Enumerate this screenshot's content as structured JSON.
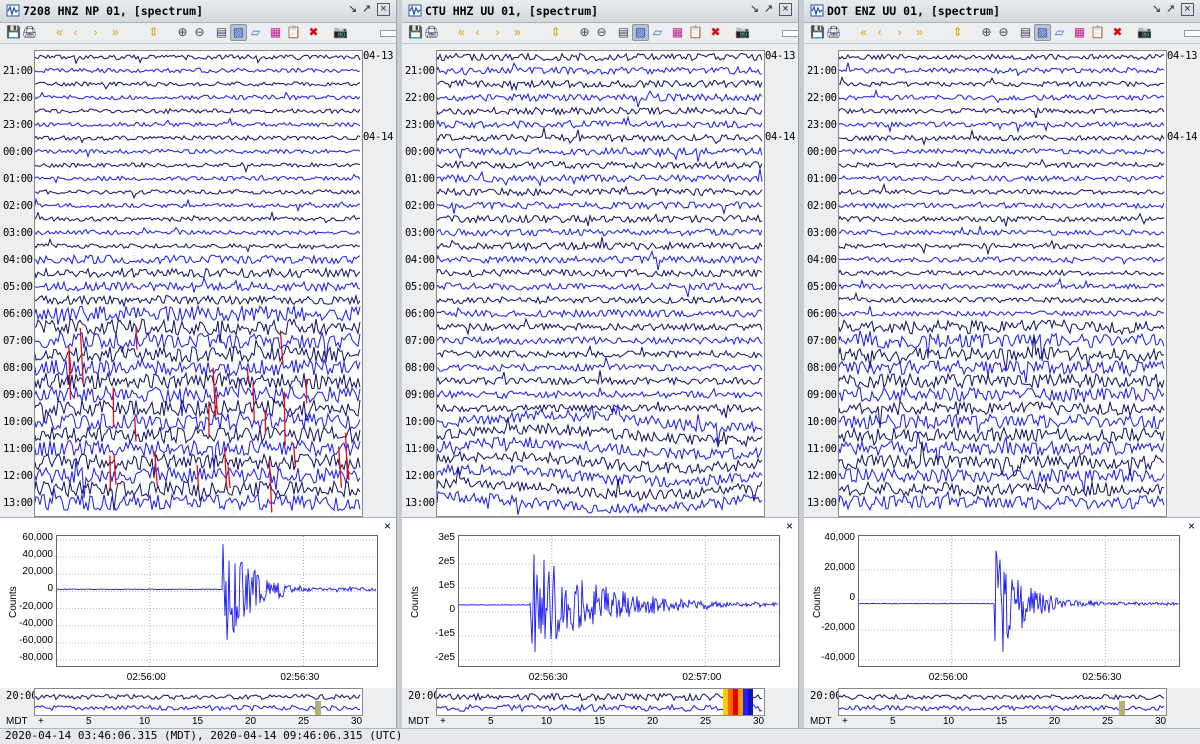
{
  "status_text": "2020-04-14 03:46:06.315 (MDT), 2020-04-14 09:46:06.315 (UTC)",
  "hour_labels": [
    "21:00",
    "22:00",
    "23:00",
    "00:00",
    "01:00",
    "02:00",
    "03:00",
    "04:00",
    "05:00",
    "06:00",
    "07:00",
    "08:00",
    "09:00",
    "10:00",
    "11:00",
    "12:00",
    "13:00"
  ],
  "date_labels": [
    "04-13",
    "04-14"
  ],
  "toolbar_icons": [
    "export-icon",
    "print-icon",
    "scroll-back-icon",
    "scroll-back-small-icon",
    "scroll-forward-small-icon",
    "scroll-forward-icon",
    "jump-icon",
    "zoom-in-icon",
    "zoom-out-icon",
    "filter-icon",
    "spectrum-icon",
    "spectrogram-icon",
    "colormap-icon",
    "clipboard-icon",
    "delete-icon",
    "camera-icon"
  ],
  "overview": {
    "hour_label": "20:00",
    "tz_label": "MDT",
    "plus_label": "+",
    "scale": [
      "5",
      "10",
      "15",
      "20",
      "25",
      "30"
    ]
  },
  "colors": {
    "dark_trace": "#101060",
    "blue_trace": "#1a1af0",
    "event_red": "#e01010"
  },
  "panes": [
    {
      "title": "7208 HNZ NP 01, [spectrum]",
      "zoom": {
        "ylabel": "Counts",
        "yticks": [
          "60,000",
          "40,000",
          "20,000",
          "0",
          "-20,000",
          "-40,000",
          "-60,000",
          "-80,000"
        ],
        "xticks": [
          "02:56:00",
          "02:56:30"
        ]
      }
    },
    {
      "title": "CTU HHZ UU 01, [spectrum]",
      "zoom": {
        "ylabel": "Counts",
        "yticks": [
          "3e5",
          "2e5",
          "1e5",
          "0",
          "-1e5",
          "-2e5"
        ],
        "xticks": [
          "02:56:30",
          "02:57:00"
        ]
      }
    },
    {
      "title": "DOT ENZ UU 01, [spectrum]",
      "zoom": {
        "ylabel": "Counts",
        "yticks": [
          "40,000",
          "20,000",
          "0",
          "-20,000",
          "-40,000"
        ],
        "xticks": [
          "02:56:00",
          "02:56:30"
        ]
      }
    }
  ]
}
